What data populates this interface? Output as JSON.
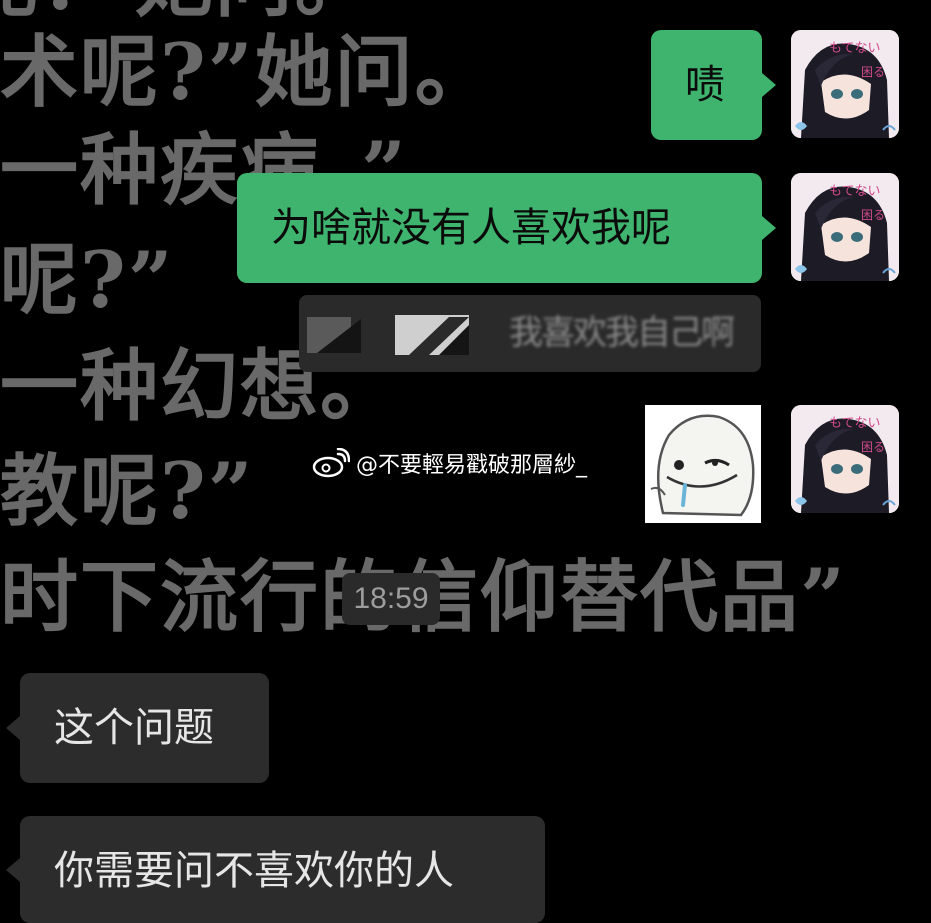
{
  "wallpaper": {
    "lines": [
      "术呢?”她问。",
      "一种疾病。”",
      "呢?”",
      "一种幻想。",
      "教呢?”",
      "时下流行的信仰替代品”"
    ]
  },
  "messages": [
    {
      "side": "out",
      "text": "啧"
    },
    {
      "side": "out",
      "text": "为啥就没有人喜欢我呢"
    },
    {
      "side": "in",
      "text": "这个问题"
    },
    {
      "side": "in",
      "text": "你需要问不喜欢你的人"
    }
  ],
  "blurred_message": {
    "text": "我喜欢我自己啊"
  },
  "watermark": {
    "icon": "weibo-icon",
    "text": "@不要輕易戳破那層紗_"
  },
  "timestamp": "18:59",
  "colors": {
    "background": "#000000",
    "outgoing_bubble": "#3fb46e",
    "incoming_bubble": "#2c2c2c",
    "wallpaper_text": "#6f6f6f"
  }
}
